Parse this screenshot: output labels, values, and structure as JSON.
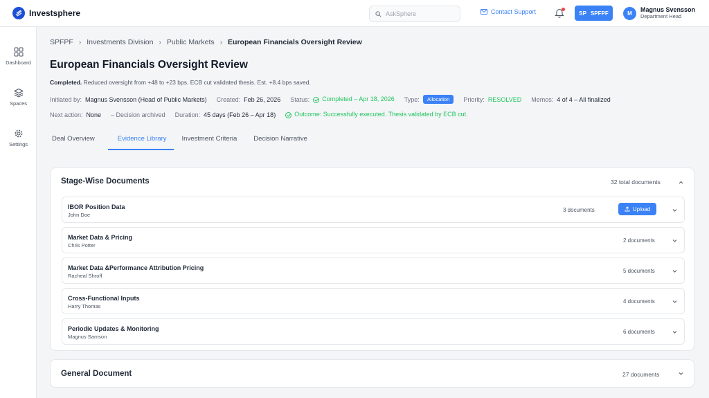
{
  "app": {
    "name": "Investsphere"
  },
  "header": {
    "search_placeholder": "AskSphere",
    "contact_label": "Contact Support",
    "space_initials": "SP",
    "space_name": "SPFPF",
    "user": {
      "initial": "M",
      "name": "Magnus Svensson",
      "role": "Department Head"
    }
  },
  "sidebar": {
    "items": [
      {
        "label": "Dashboard",
        "icon": "grid-icon"
      },
      {
        "label": "Spaces",
        "icon": "layers-icon"
      },
      {
        "label": "Settings",
        "icon": "gear-icon"
      }
    ]
  },
  "breadcrumb": [
    "SPFPF",
    "Investments Division",
    "Public Markets",
    "European Financials Oversight Review"
  ],
  "page": {
    "title": "European Financials Oversight Review",
    "summary_status": "Completed.",
    "summary_text": "Reduced oversight from +48 to +23 bps. ECB cut validated thesis. Est. +8.4 bps saved."
  },
  "meta": {
    "initiated_label": "Initiated by:",
    "initiated_value": "Magnus Svensson (Head of Public Markets)",
    "created_label": "Created:",
    "created_value": "Feb 26, 2026",
    "status_label": "Status:",
    "status_value": "Completed – Apr 18, 2026",
    "type_label": "Type:",
    "type_value": "Allocation",
    "priority_label": "Priority:",
    "priority_value": "RESOLVED",
    "memos_label": "Memos:",
    "memos_value": "4 of 4 – All finalized",
    "next_label": "Next action:",
    "next_value": "None",
    "archived_text": "– Decision archived",
    "duration_label": "Duration:",
    "duration_value": "45 days (Feb 26 – Apr 18)",
    "outcome_text": "Outcome: Successfully executed. Thesis validated by ECB cut."
  },
  "tabs": [
    "Deal Overview",
    "Evidence Library",
    "Investment Criteria",
    "Decision Narrative"
  ],
  "stage_docs": {
    "title": "Stage-Wise Documents",
    "total": "32 total documents",
    "rows": [
      {
        "title": "IBOR Position Data",
        "owner": "John Doe",
        "count": "3 documents",
        "upload": "Upload"
      },
      {
        "title": "Market Data & Pricing",
        "owner": "Chris Potter",
        "count": "2 documents"
      },
      {
        "title": "Market Data &Performance Attribution Pricing",
        "owner": "Racheal Shroff",
        "count": "5 documents"
      },
      {
        "title": "Cross-Functional Inputs",
        "owner": "Harry Thomas",
        "count": "4 documents"
      },
      {
        "title": "Periodic Updates & Monitoring",
        "owner": "Magnus Samson",
        "count": "6 documents"
      }
    ]
  },
  "general_docs": {
    "title": "General Document",
    "count": "27 documents"
  },
  "colors": {
    "accent": "#3b82f6",
    "success": "#22c55e",
    "alert": "#ef4444"
  }
}
